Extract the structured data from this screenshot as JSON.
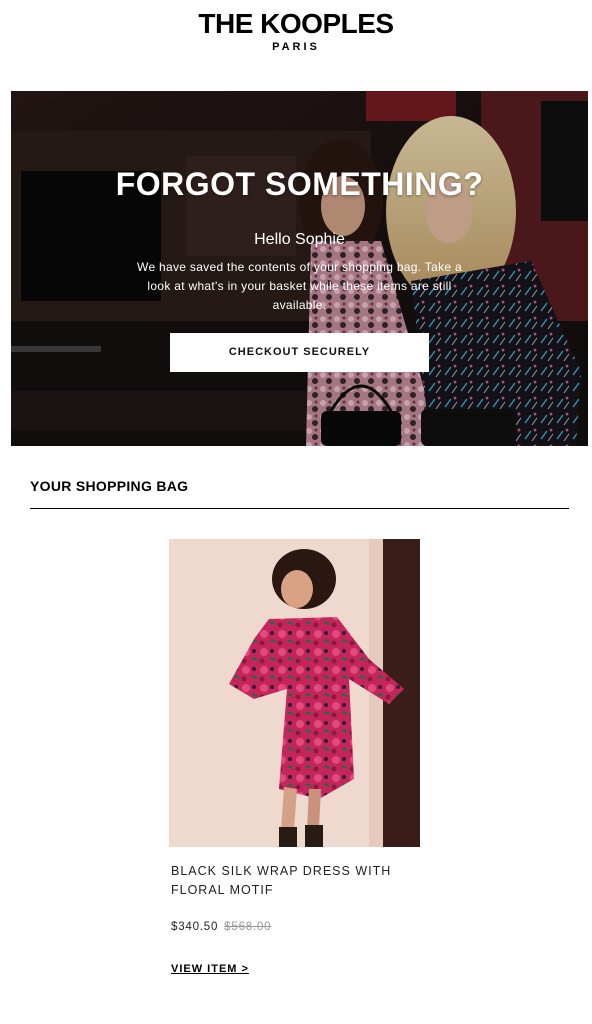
{
  "brand": {
    "name": "THE KOOPLES",
    "tagline": "PARIS"
  },
  "hero": {
    "title": "FORGOT SOMETHING?",
    "greeting": "Hello Sophie",
    "message": "We have saved the contents of your shopping bag. Take a look at what's in your basket while these items are still available.",
    "cta_label": "CHECKOUT SECURELY"
  },
  "bag": {
    "title": "YOUR SHOPPING BAG",
    "items": [
      {
        "name": "BLACK SILK WRAP DRESS WITH FLORAL MOTIF",
        "price": "$340.50",
        "original_price": "$568.00",
        "link_label": "VIEW ITEM >"
      }
    ]
  },
  "colors": {
    "text": "#111111",
    "button_bg": "#ffffff",
    "divider": "#000000",
    "strikethrough_price": "#999999"
  }
}
